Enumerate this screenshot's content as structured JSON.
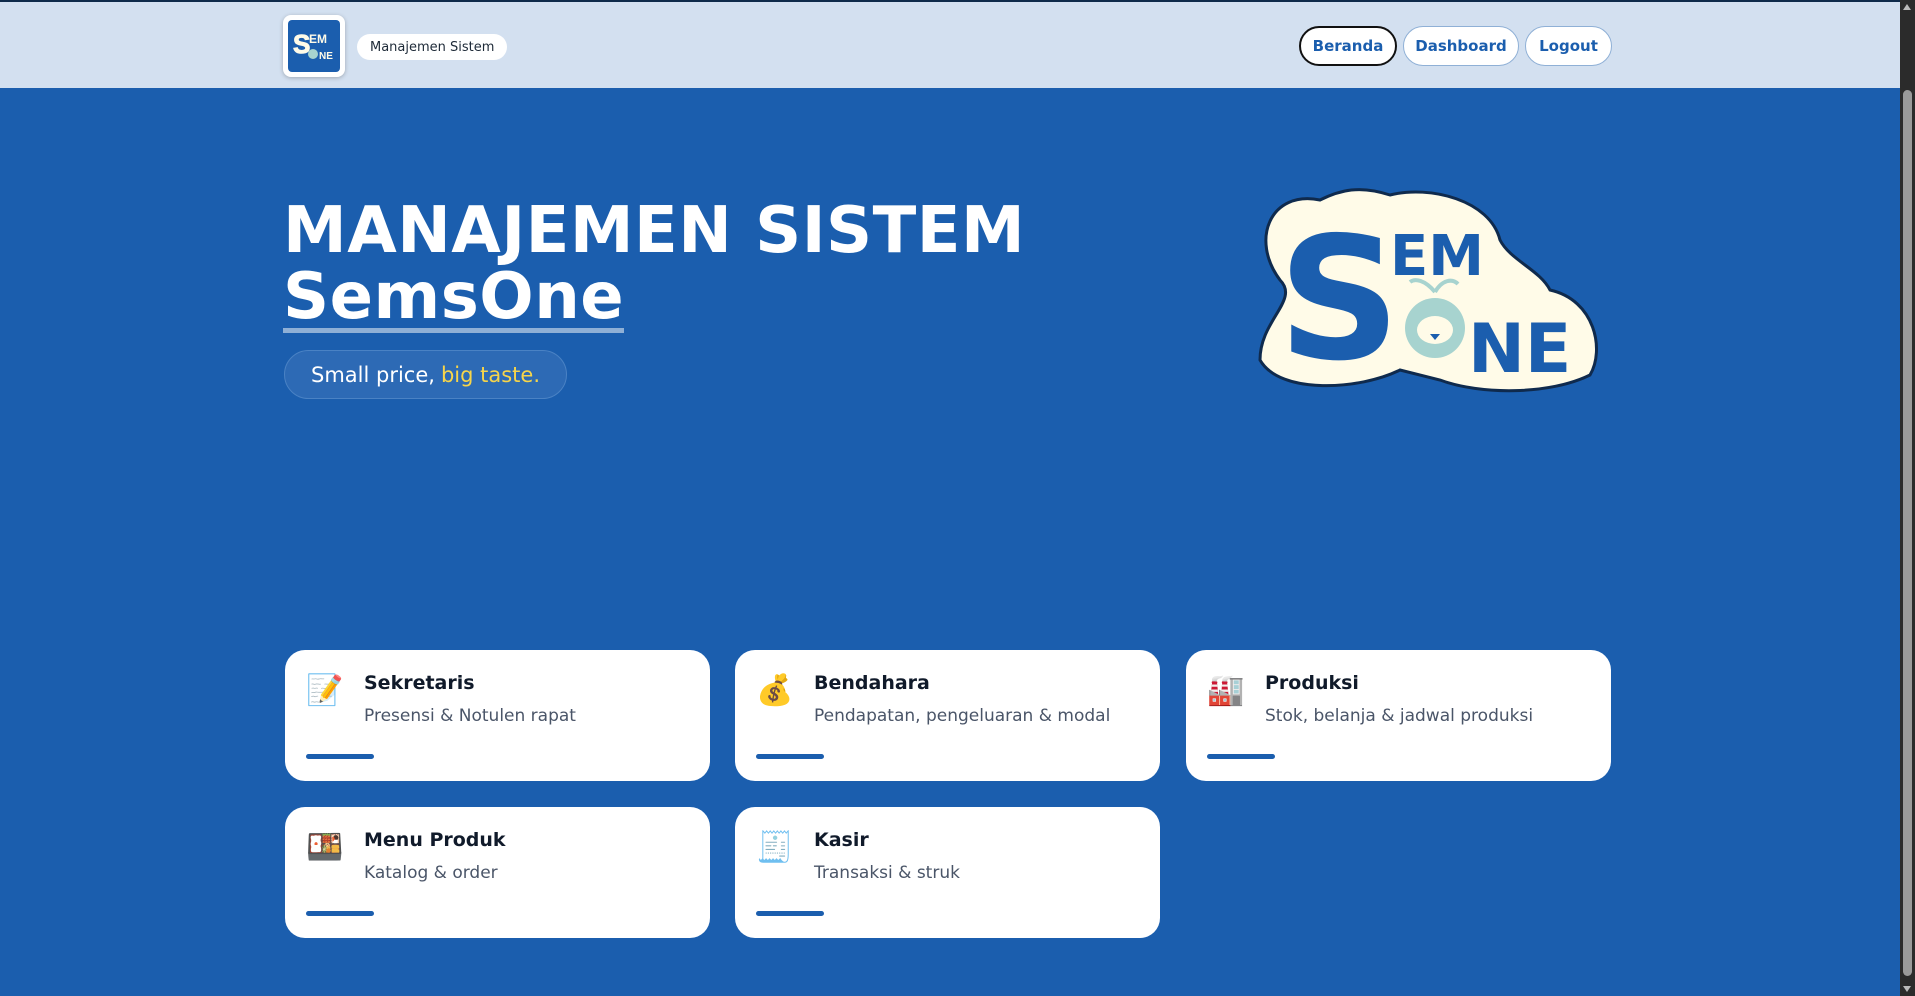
{
  "header": {
    "logo_text": "SemsOne",
    "tag": "Manajemen Sistem",
    "nav": [
      "Beranda",
      "Dashboard",
      "Logout"
    ]
  },
  "hero": {
    "title_line1": "MANAJEMEN SISTEM",
    "title_line2": "SemsOne",
    "tagline_plain": "Small price,",
    "tagline_highlight": "big taste.",
    "logo_text": "SemsOne"
  },
  "cards": [
    {
      "title": "Sekretaris",
      "subtitle": "Presensi & Notulen rapat",
      "icon": "memo-icon",
      "glyph": "📝"
    },
    {
      "title": "Bendahara",
      "subtitle": "Pendapatan, pengeluaran & modal",
      "icon": "money-bag-icon",
      "glyph": "💰"
    },
    {
      "title": "Produksi",
      "subtitle": "Stok, belanja & jadwal produksi",
      "icon": "factory-icon",
      "glyph": "🏭"
    },
    {
      "title": "Menu Produk",
      "subtitle": "Katalog & order",
      "icon": "bento-box-icon",
      "glyph": "🍱"
    },
    {
      "title": "Kasir",
      "subtitle": "Transaksi & struk",
      "icon": "receipt-icon",
      "glyph": "🧾"
    }
  ],
  "colors": {
    "primary": "#1b5eae",
    "header_bg": "#d3e0f0",
    "highlight": "#f7d54a",
    "card_bg": "#ffffff"
  }
}
